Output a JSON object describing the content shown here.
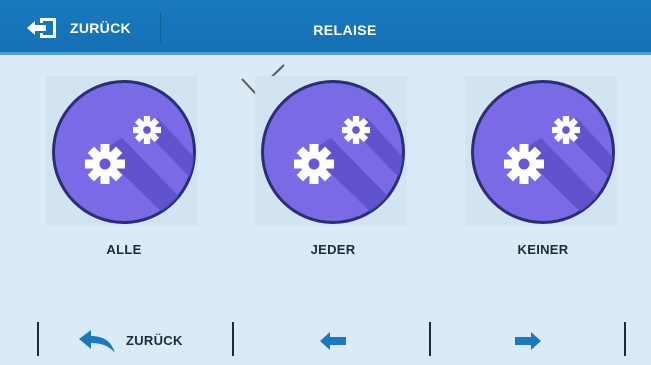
{
  "header": {
    "back_label": "ZURÜCK",
    "title": "RELAISE"
  },
  "options": [
    {
      "label": "ALLE",
      "icon": "gears-icon",
      "selected": false
    },
    {
      "label": "JEDER",
      "icon": "gears-icon",
      "selected": true
    },
    {
      "label": "KEINER",
      "icon": "gears-icon",
      "selected": false
    }
  ],
  "footer": {
    "back_label": "ZURÜCK",
    "prev_icon": "arrow-left-icon",
    "next_icon": "arrow-right-icon"
  },
  "colors": {
    "header": "#1670b4",
    "background": "#daeaf6",
    "circle": "#7a6ae6",
    "arrow": "#1a79bd"
  }
}
